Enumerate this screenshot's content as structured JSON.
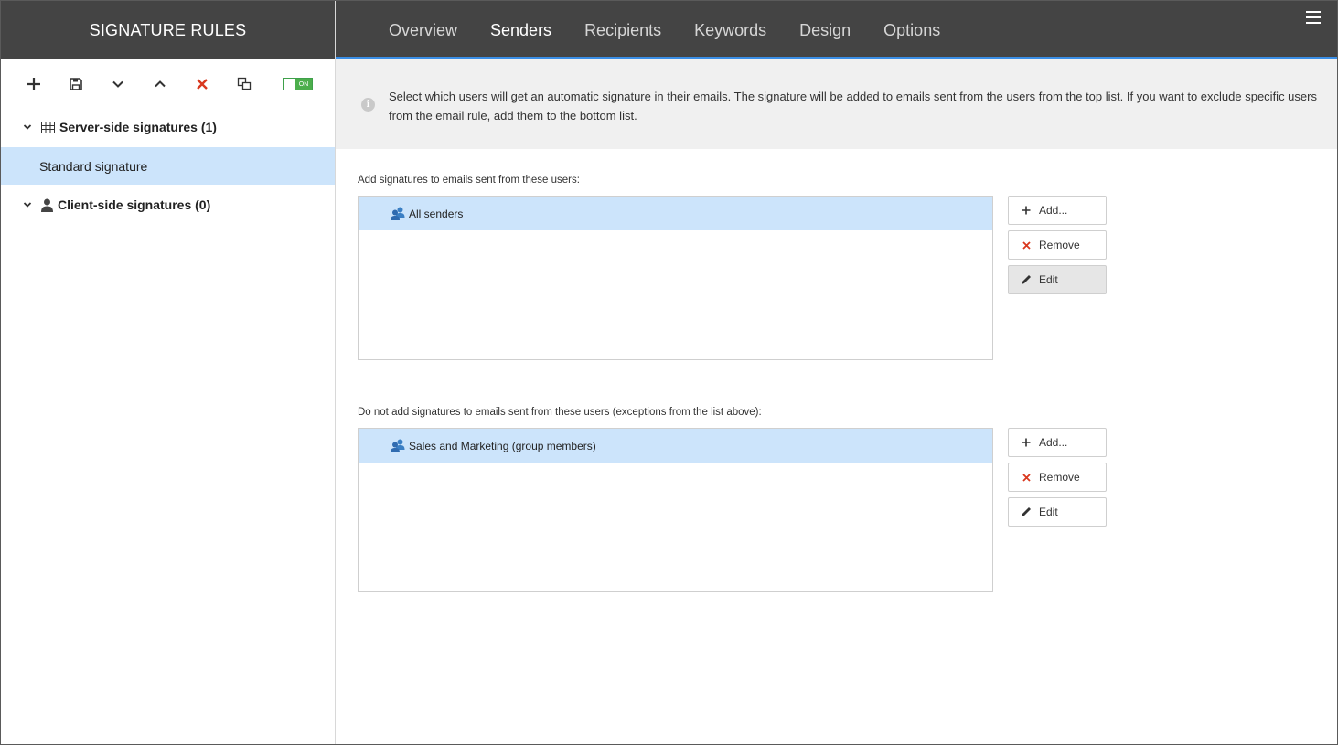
{
  "app": {
    "title": "SIGNATURE RULES"
  },
  "toolbar": {
    "buttons": [
      "add-icon",
      "save-icon",
      "move-down-icon",
      "move-up-icon",
      "delete-icon",
      "duplicate-icon"
    ],
    "toggle_label": "ON",
    "toggle_color": "#4cae4c"
  },
  "tree": {
    "server_group": "Server-side signatures (1)",
    "server_items": [
      "Standard signature"
    ],
    "client_group": "Client-side signatures (0)"
  },
  "nav": {
    "tabs": [
      "Overview",
      "Senders",
      "Recipients",
      "Keywords",
      "Design",
      "Options"
    ],
    "active_tab": "Senders"
  },
  "info": {
    "text": "Select which users will get an automatic signature in their emails. The signature will be added to emails sent from the users from the top list. If you want to exclude specific users from the email rule, add them to the bottom list."
  },
  "include_section": {
    "label": "Add signatures to emails sent from these users:",
    "items": [
      "All senders"
    ],
    "add_label": "Add...",
    "remove_label": "Remove",
    "edit_label": "Edit"
  },
  "exclude_section": {
    "label": "Do not add signatures to emails sent from these users (exceptions from the list above):",
    "items": [
      "Sales and Marketing (group members)"
    ],
    "add_label": "Add...",
    "remove_label": "Remove",
    "edit_label": "Edit"
  },
  "colors": {
    "header_bg": "#444444",
    "accent": "#3a8ee6",
    "selection": "#cce4fb",
    "delete_red": "#d9381e"
  }
}
